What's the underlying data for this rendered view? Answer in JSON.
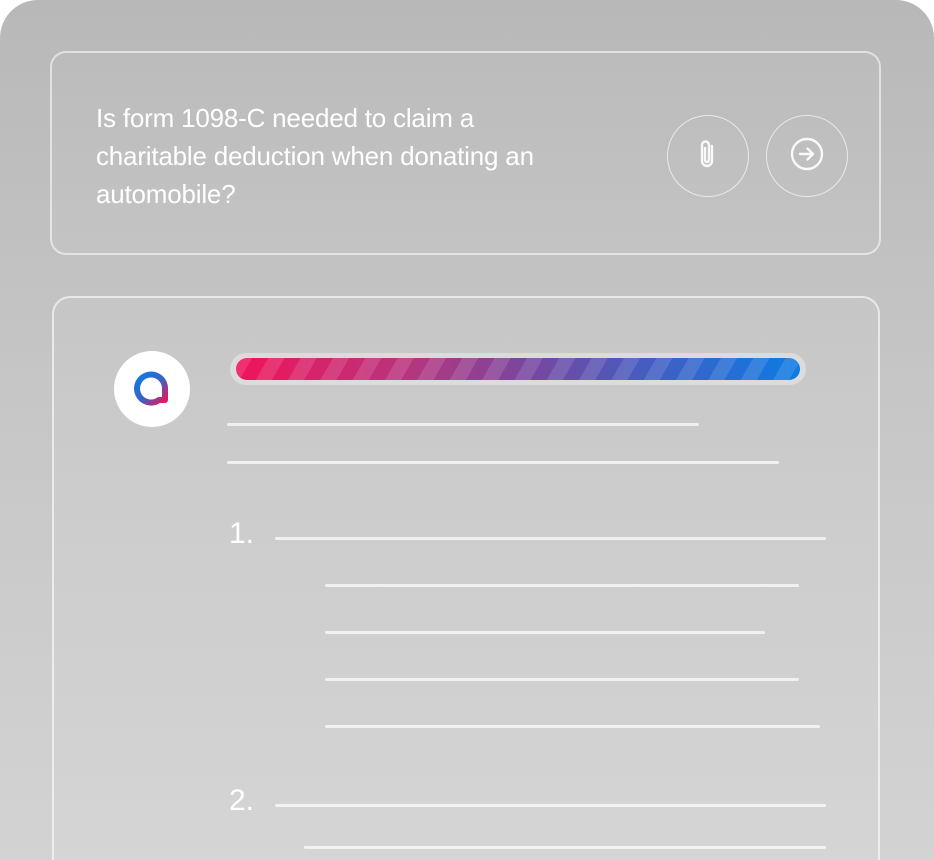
{
  "query": {
    "text": "Is form 1098-C needed to claim a charitable deduction when donating an automobile?",
    "attach_icon": "paperclip-icon",
    "send_icon": "arrow-right-circle-icon"
  },
  "answer": {
    "avatar_icon": "q-logo-icon",
    "progress_fraction": 1.0,
    "progress_colors": [
      "#f0135a",
      "#77479f",
      "#0c7ce4"
    ],
    "list_numbers": [
      "1.",
      "2."
    ]
  }
}
